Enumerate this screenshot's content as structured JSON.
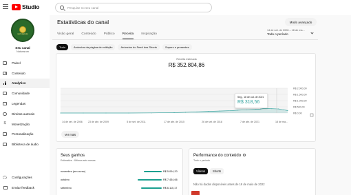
{
  "app": {
    "logo_text": "Studio"
  },
  "search": {
    "placeholder": "Pesquise no seu canal"
  },
  "channel": {
    "name": "Seu canal",
    "handle": "Naturarum",
    "avatar_text": "NATURARUM"
  },
  "sidebar": {
    "items": [
      {
        "label": "Painel",
        "icon": "dashboard-icon"
      },
      {
        "label": "Conteúdo",
        "icon": "content-icon"
      },
      {
        "label": "Analytics",
        "icon": "analytics-icon",
        "active": true
      },
      {
        "label": "Comunidade",
        "icon": "community-icon"
      },
      {
        "label": "Legendas",
        "icon": "subtitles-icon"
      },
      {
        "label": "Direitos autorais",
        "icon": "copyright-icon"
      },
      {
        "label": "Monetização",
        "icon": "monetization-icon"
      },
      {
        "label": "Personalização",
        "icon": "customization-icon"
      },
      {
        "label": "Biblioteca de áudio",
        "icon": "audio-library-icon"
      }
    ],
    "bottom": [
      {
        "label": "Configurações",
        "icon": "settings-icon"
      },
      {
        "label": "Enviar feedback",
        "icon": "feedback-icon"
      }
    ]
  },
  "header": {
    "title": "Estatísticas do canal",
    "advanced_mode": "Modo avançado",
    "date_range_top": "14 de set. de 2006 – 18 de ma...",
    "date_range": "Todo o período"
  },
  "tabs": [
    "Visão geral",
    "Conteúdo",
    "Público",
    "Receita",
    "Inspiração"
  ],
  "active_tab": "Receita",
  "chips": [
    "Tudo",
    "Anúncios da página de exibição",
    "Anúncios do Feed dos Shorts",
    "Supers e presentes"
  ],
  "revenue": {
    "label": "Receita estimada",
    "value": "R$ 352.804,86",
    "tooltip_date": "Seg., 18 de out. de 2021",
    "tooltip_value": "R$ 318,56",
    "more_label": "Ver mais",
    "accent": "#35a4a0"
  },
  "chart_data": {
    "type": "area",
    "title": "",
    "x_ticks": [
      "14 de set. de 2006",
      "23 de abr. de 2009",
      "5 de set. de 2011",
      "17 de abr. de 2015",
      "26 de set. de 2018",
      "7 de abr. de 2021",
      "18 de ma..."
    ],
    "y_ticks": [
      "R$ 2.000,00",
      "R$ 1.500,00",
      "R$ 1.000,00",
      "R$ 500,00",
      "R$ 0,00"
    ],
    "ylim": [
      0,
      2000
    ],
    "series": [
      {
        "x": [
          0,
          0.1,
          0.2,
          0.3,
          0.4,
          0.5,
          0.55,
          0.6,
          0.65,
          0.7,
          0.75,
          0.78,
          0.82,
          0.86,
          0.88,
          0.9,
          0.93,
          0.96,
          0.98,
          1.0
        ],
        "values": [
          0,
          0,
          0,
          0,
          10,
          30,
          60,
          90,
          130,
          160,
          190,
          230,
          260,
          300,
          320,
          380,
          350,
          330,
          260,
          200
        ]
      }
    ],
    "grid": true,
    "legend": "none"
  },
  "earnings": {
    "title": "Seus ganhos",
    "subtitle": "Estimativa · Últimos seis meses",
    "rows": [
      {
        "month": "novembro (em curso)",
        "amount": "R$ 5.004,20",
        "fraction": 0.72
      },
      {
        "month": "outubro",
        "amount": "R$ 7.434,66",
        "fraction": 0.98
      },
      {
        "month": "setembro",
        "amount": "R$ 6.110,17",
        "fraction": 0.82
      }
    ]
  },
  "performance": {
    "title": "Performance do conteúdo",
    "subtitle": "Todo o período",
    "chips": [
      "Vídeos",
      "Shorts"
    ],
    "note": "Não há dados disponíveis antes de 19 de maio de 2022"
  }
}
